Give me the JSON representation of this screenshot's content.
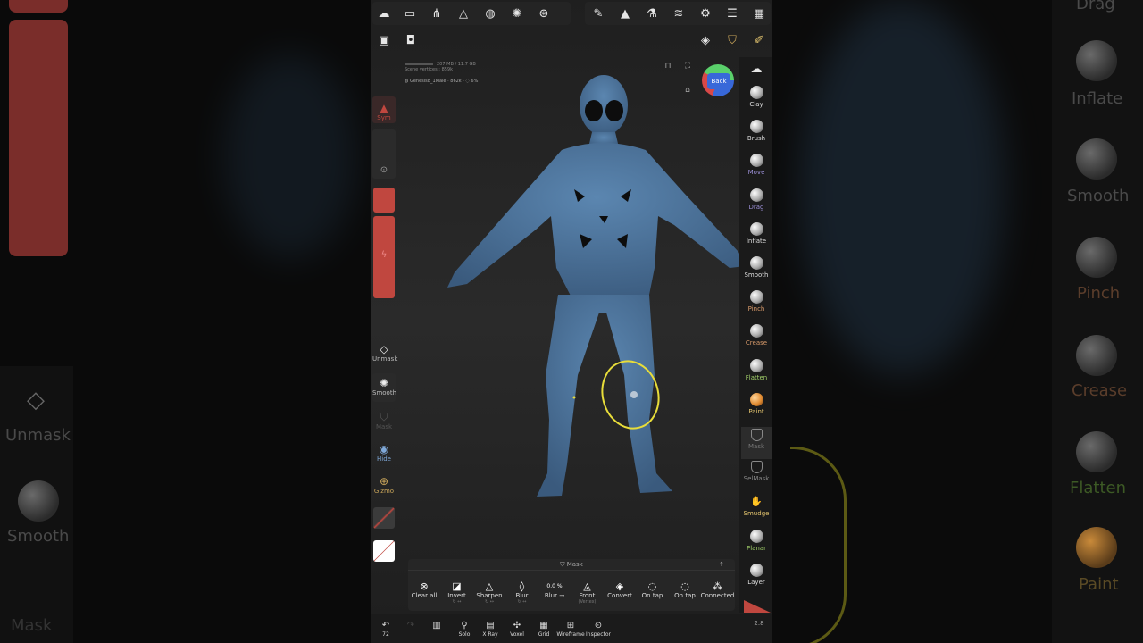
{
  "left_ghost": {
    "unmask": "Unmask",
    "smooth": "Smooth",
    "mask": "Mask"
  },
  "right_ghost": {
    "drag": "Drag",
    "inflate": "Inflate",
    "smooth": "Smooth",
    "pinch": "Pinch",
    "crease": "Crease",
    "flatten": "Flatten",
    "paint": "Paint"
  },
  "stats": {
    "memory": "207 MB / 11.7 GB",
    "vertices": "Scene vertices : 859k",
    "mesh": "Genesis8_1Male",
    "mesh_info": "· 862k · ◌ 6%"
  },
  "view_cube": {
    "label": "Back"
  },
  "left_tools": {
    "sym": "Sym",
    "unmask": "Unmask",
    "smooth": "Smooth",
    "mask": "Mask",
    "hide": "Hide",
    "gizmo": "Gizmo"
  },
  "right_tools": [
    {
      "label": "Clay",
      "color": "#dddddd"
    },
    {
      "label": "Brush",
      "color": "#dddddd"
    },
    {
      "label": "Move",
      "color": "#9b8fd6"
    },
    {
      "label": "Drag",
      "color": "#9b8fd6"
    },
    {
      "label": "Inflate",
      "color": "#dddddd"
    },
    {
      "label": "Smooth",
      "color": "#dddddd"
    },
    {
      "label": "Pinch",
      "color": "#d89a6a"
    },
    {
      "label": "Crease",
      "color": "#d89a6a"
    },
    {
      "label": "Flatten",
      "color": "#a4d36b"
    },
    {
      "label": "Paint",
      "color": "#e3c46e"
    },
    {
      "label": "Mask",
      "color": "#777777"
    },
    {
      "label": "SelMask",
      "color": "#888888"
    },
    {
      "label": "Smudge",
      "color": "#e3c46e"
    },
    {
      "label": "Planar",
      "color": "#a4d36b"
    },
    {
      "label": "Layer",
      "color": "#dddddd"
    }
  ],
  "mask_panel": {
    "title": "Mask",
    "items": [
      {
        "label": "Clear all",
        "sub": "",
        "icon": "⊗"
      },
      {
        "label": "Invert",
        "sub": "↻ ↔",
        "icon": "◪"
      },
      {
        "label": "Sharpen",
        "sub": "↻ ↔",
        "icon": "△"
      },
      {
        "label": "Blur",
        "sub": "↻ ↔",
        "icon": "◊"
      },
      {
        "label": "Blur →",
        "sub": "",
        "icon": "0.0 %"
      },
      {
        "label": "Front",
        "sub": "(Vertex)",
        "icon": "◬"
      },
      {
        "label": "Convert",
        "sub": "",
        "icon": "◈"
      },
      {
        "label": "On tap",
        "sub": "",
        "icon": "◌"
      },
      {
        "label": "On tap",
        "sub": "",
        "icon": "◌"
      },
      {
        "label": "Connected",
        "sub": "",
        "icon": "⁂"
      }
    ]
  },
  "bottom_bar": {
    "undo_count": "72",
    "items": [
      "Solo",
      "X Ray",
      "Voxel",
      "Grid",
      "Wireframe",
      "Inspector"
    ],
    "right_value": "2.8"
  },
  "colors": {
    "model": "#4a6f96",
    "accent_red": "#c0473f",
    "selection": "#e8dd3a"
  }
}
